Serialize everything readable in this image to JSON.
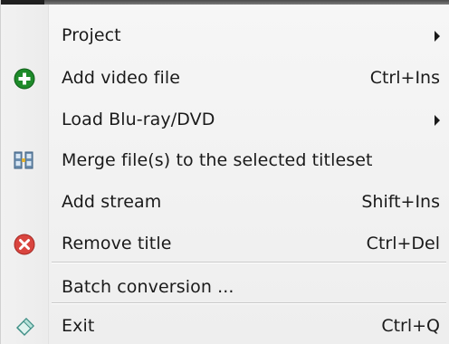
{
  "menu": {
    "items": [
      {
        "label": "Project",
        "shortcut": "",
        "icon": "",
        "submenu": true
      },
      {
        "label": "Add video file",
        "shortcut": "Ctrl+Ins",
        "icon": "add-green-circle-icon",
        "submenu": false
      },
      {
        "label": "Load Blu-ray/DVD",
        "shortcut": "",
        "icon": "",
        "submenu": true
      },
      {
        "label": "Merge file(s) to the selected titleset",
        "shortcut": "",
        "icon": "merge-film-icon",
        "submenu": false
      },
      {
        "label": "Add stream",
        "shortcut": "Shift+Ins",
        "icon": "",
        "submenu": false
      },
      {
        "label": "Remove title",
        "shortcut": "Ctrl+Del",
        "icon": "remove-red-circle-icon",
        "submenu": false
      },
      {
        "label": "Batch conversion ...",
        "shortcut": "",
        "icon": "",
        "submenu": false
      },
      {
        "label": "Exit",
        "shortcut": "Ctrl+Q",
        "icon": "exit-eraser-icon",
        "submenu": false
      }
    ]
  },
  "colors": {
    "menu_background": "#f2f2f2",
    "text": "#1a1a1a",
    "add_icon_green": "#1e8a2a",
    "remove_icon_red": "#d9453f"
  }
}
